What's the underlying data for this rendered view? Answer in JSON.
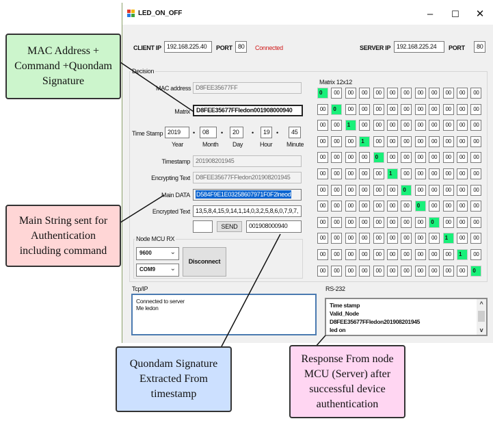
{
  "window": {
    "title": "LED_ON_OFF",
    "controls": {
      "minimize": "–",
      "maximize": "☐",
      "close": "✕"
    }
  },
  "connection": {
    "client_ip_label": "CLIENT IP",
    "client_ip": "192.168.225.40",
    "client_port_label": "PORT",
    "client_port": "80",
    "status": "Connected",
    "status_color": "#d01818",
    "server_ip_label": "SERVER IP",
    "server_ip": "192.168.225.24",
    "server_port_label": "PORT",
    "server_port": "80"
  },
  "decision": {
    "group_label": "Decision",
    "mac_label": "MAC address",
    "mac_value": "D8FEE35677FF",
    "matrix_label": "Matrix",
    "matrix_value": "D8FEE35677FFledon001908000940",
    "timestamp_label": "Time Stamp",
    "year": "2019",
    "month": "08",
    "day": "20",
    "hour": "19",
    "minute": "45",
    "year_label": "Year",
    "month_label": "Month",
    "day_label": "Day",
    "hour_label": "Hour",
    "minute_label": "Minute",
    "separator": "•",
    "timestamp_field_label": "Timestamp",
    "timestamp_value": "201908201945",
    "encrypting_label": "Encrypting Text",
    "encrypting_value": "D8FEE35677FFledon201908201945",
    "main_data_label": "Main DATA",
    "main_data_value": "D584F9E1E03258607971F0F2lneod",
    "encrypted_label": "Encrypted Text",
    "encrypted_value": "13,5,8,4,15,9,14,1,14,0,3,2,5,8,6,0,7,9,7,",
    "send_input_value": "",
    "send_label": "SEND",
    "signature_value": "001908000940"
  },
  "node_mcu": {
    "group_label": "Node MCU RX",
    "baud": "9600",
    "port": "COM9",
    "disconnect_label": "Disconnect"
  },
  "matrix_panel": {
    "label": "Matrix 12x12",
    "default_value": "00",
    "active_color": "#19f07a",
    "diagonal_values": [
      "0",
      "0",
      "1",
      "1",
      "0",
      "1",
      "0",
      "0",
      "0",
      "1",
      "1",
      "0"
    ]
  },
  "tcp": {
    "label": "Tcp/IP",
    "lines": [
      "Connected to server",
      "Me ledon"
    ]
  },
  "rs232": {
    "label": "RS-232",
    "lines": [
      "Time stamp",
      "Valid_Node",
      "D8FEE35677FFledon201908201945",
      "led on"
    ],
    "scroll_up": "^",
    "scroll_down": "v"
  },
  "callouts": {
    "mac_command": "MAC Address + Command +Quondam Signature",
    "main_string": "Main String sent for Authentication including command",
    "quondam": "Quondam Signature Extracted From timestamp",
    "response": "Response From node MCU (Server) after successful device authentication",
    "colors": {
      "green": "#ccf5cc",
      "red": "#ffd6d6",
      "blue": "#cce0ff",
      "pink": "#ffd6f2"
    }
  }
}
